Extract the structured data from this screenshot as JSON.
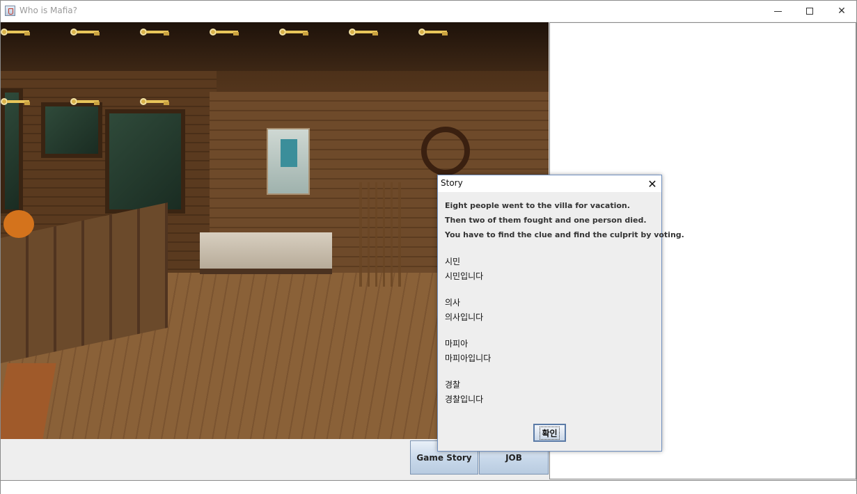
{
  "window": {
    "title": "Who is Mafia?",
    "minimize_icon": "minimize-icon",
    "maximize_icon": "maximize-icon",
    "close_symbol": "✕"
  },
  "scene": {
    "key_icon": "key-icon",
    "key_count_row1": 7,
    "key_count_row2": 3
  },
  "buttons": {
    "game_story": "Game Story",
    "job": "JOB"
  },
  "dialog": {
    "title": "Story",
    "close_symbol": "✕",
    "story_lines": [
      "Eight people went to the villa for vacation.",
      "Then two of them fought and one person died.",
      "You have to find the clue and find the culprit by voting."
    ],
    "roles": [
      {
        "name": "시민",
        "description": "시민입니다"
      },
      {
        "name": "의사",
        "description": "의사입니다"
      },
      {
        "name": "마피아",
        "description": "마피아입니다"
      },
      {
        "name": "경찰",
        "description": "경찰입니다"
      }
    ],
    "ok_label": "확인"
  },
  "colors": {
    "button_gradient_top": "#e9f0f8",
    "button_gradient_bottom": "#b8cbe0",
    "dialog_border": "#6f8fbf",
    "key_gold": "#e8c55a"
  }
}
